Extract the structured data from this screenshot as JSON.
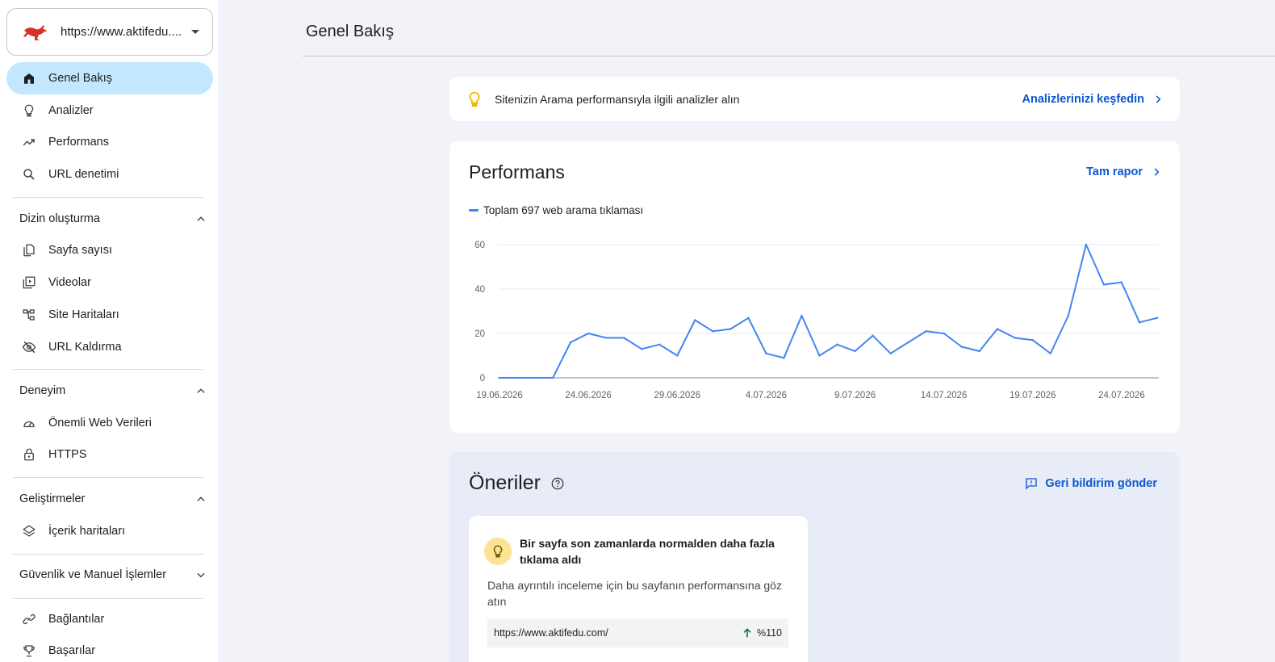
{
  "property": {
    "url": "https://www.aktifedu....",
    "logo": "kangaroo-logo",
    "dropdown_icon": "caret-down-icon"
  },
  "sidebar": {
    "top_items": [
      {
        "label": "Genel Bakış",
        "icon": "home-icon",
        "active": true
      },
      {
        "label": "Analizler",
        "icon": "lightbulb-icon"
      },
      {
        "label": "Performans",
        "icon": "trending-up-icon"
      },
      {
        "label": "URL denetimi",
        "icon": "search-icon"
      }
    ],
    "sections": [
      {
        "title": "Dizin oluşturma",
        "expanded": true,
        "items": [
          {
            "label": "Sayfa sayısı",
            "icon": "pages-icon"
          },
          {
            "label": "Videolar",
            "icon": "video-library-icon"
          },
          {
            "label": "Site Haritaları",
            "icon": "sitemap-icon"
          },
          {
            "label": "URL Kaldırma",
            "icon": "visibility-off-icon"
          }
        ]
      },
      {
        "title": "Deneyim",
        "expanded": true,
        "items": [
          {
            "label": "Önemli Web Verileri",
            "icon": "speed-icon"
          },
          {
            "label": "HTTPS",
            "icon": "lock-icon"
          }
        ]
      },
      {
        "title": "Geliştirmeler",
        "expanded": true,
        "items": [
          {
            "label": "İçerik haritaları",
            "icon": "layers-icon"
          }
        ]
      },
      {
        "title": "Güvenlik ve Manuel İşlemler",
        "expanded": false,
        "items": []
      }
    ],
    "bottom_items": [
      {
        "label": "Bağlantılar",
        "icon": "link-icon"
      },
      {
        "label": "Başarılar",
        "icon": "trophy-icon"
      }
    ]
  },
  "main": {
    "title": "Genel Bakış",
    "insight": {
      "text": "Sitenizin Arama performansıyla ilgili analizler alın",
      "link": "Analizlerinizi keşfedin"
    },
    "performance": {
      "title": "Performans",
      "full_report": "Tam rapor",
      "legend": "Toplam 697 web arama tıklaması"
    },
    "suggestions": {
      "title": "Öneriler",
      "feedback": "Geri bildirim gönder",
      "card": {
        "headline": "Bir sayfa son zamanlarda normalden daha fazla tıklama aldı",
        "description": "Daha ayrıntılı inceleme için bu sayfanın performansına göz atın",
        "url": "https://www.aktifedu.com/",
        "change": "%110"
      }
    }
  },
  "colors": {
    "accent": "#0b57d0",
    "active_nav": "#c2e7ff",
    "line": "#4285f4",
    "positive": "#137333"
  },
  "chart_data": {
    "type": "line",
    "series": [
      {
        "name": "Toplam 697 web arama tıklaması",
        "values": [
          0,
          0,
          0,
          0,
          16,
          20,
          18,
          18,
          13,
          15,
          10,
          26,
          21,
          22,
          27,
          11,
          9,
          28,
          10,
          15,
          12,
          19,
          11,
          16,
          21,
          20,
          14,
          12,
          22,
          18,
          17,
          11,
          28,
          60,
          42,
          43,
          25,
          27
        ]
      }
    ],
    "x": [
      "19.06.2026",
      "20.06.2026",
      "21.06.2026",
      "22.06.2026",
      "23.06.2026",
      "24.06.2026",
      "25.06.2026",
      "26.06.2026",
      "27.06.2026",
      "28.06.2026",
      "29.06.2026",
      "30.06.2026",
      "1.07.2026",
      "2.07.2026",
      "3.07.2026",
      "4.07.2026",
      "5.07.2026",
      "6.07.2026",
      "7.07.2026",
      "8.07.2026",
      "9.07.2026",
      "10.07.2026",
      "11.07.2026",
      "12.07.2026",
      "13.07.2026",
      "14.07.2026",
      "15.07.2026",
      "16.07.2026",
      "17.07.2026",
      "18.07.2026",
      "19.07.2026",
      "20.07.2026",
      "21.07.2026",
      "22.07.2026",
      "23.07.2026",
      "24.07.2026",
      "25.07.2026",
      "26.07.2026"
    ],
    "x_tick_labels": [
      "19.06.2026",
      "24.06.2026",
      "29.06.2026",
      "4.07.2026",
      "9.07.2026",
      "14.07.2026",
      "19.07.2026",
      "24.07.2026"
    ],
    "y_ticks": [
      0,
      20,
      40,
      60
    ],
    "ylim": [
      0,
      60
    ],
    "grid": true
  }
}
